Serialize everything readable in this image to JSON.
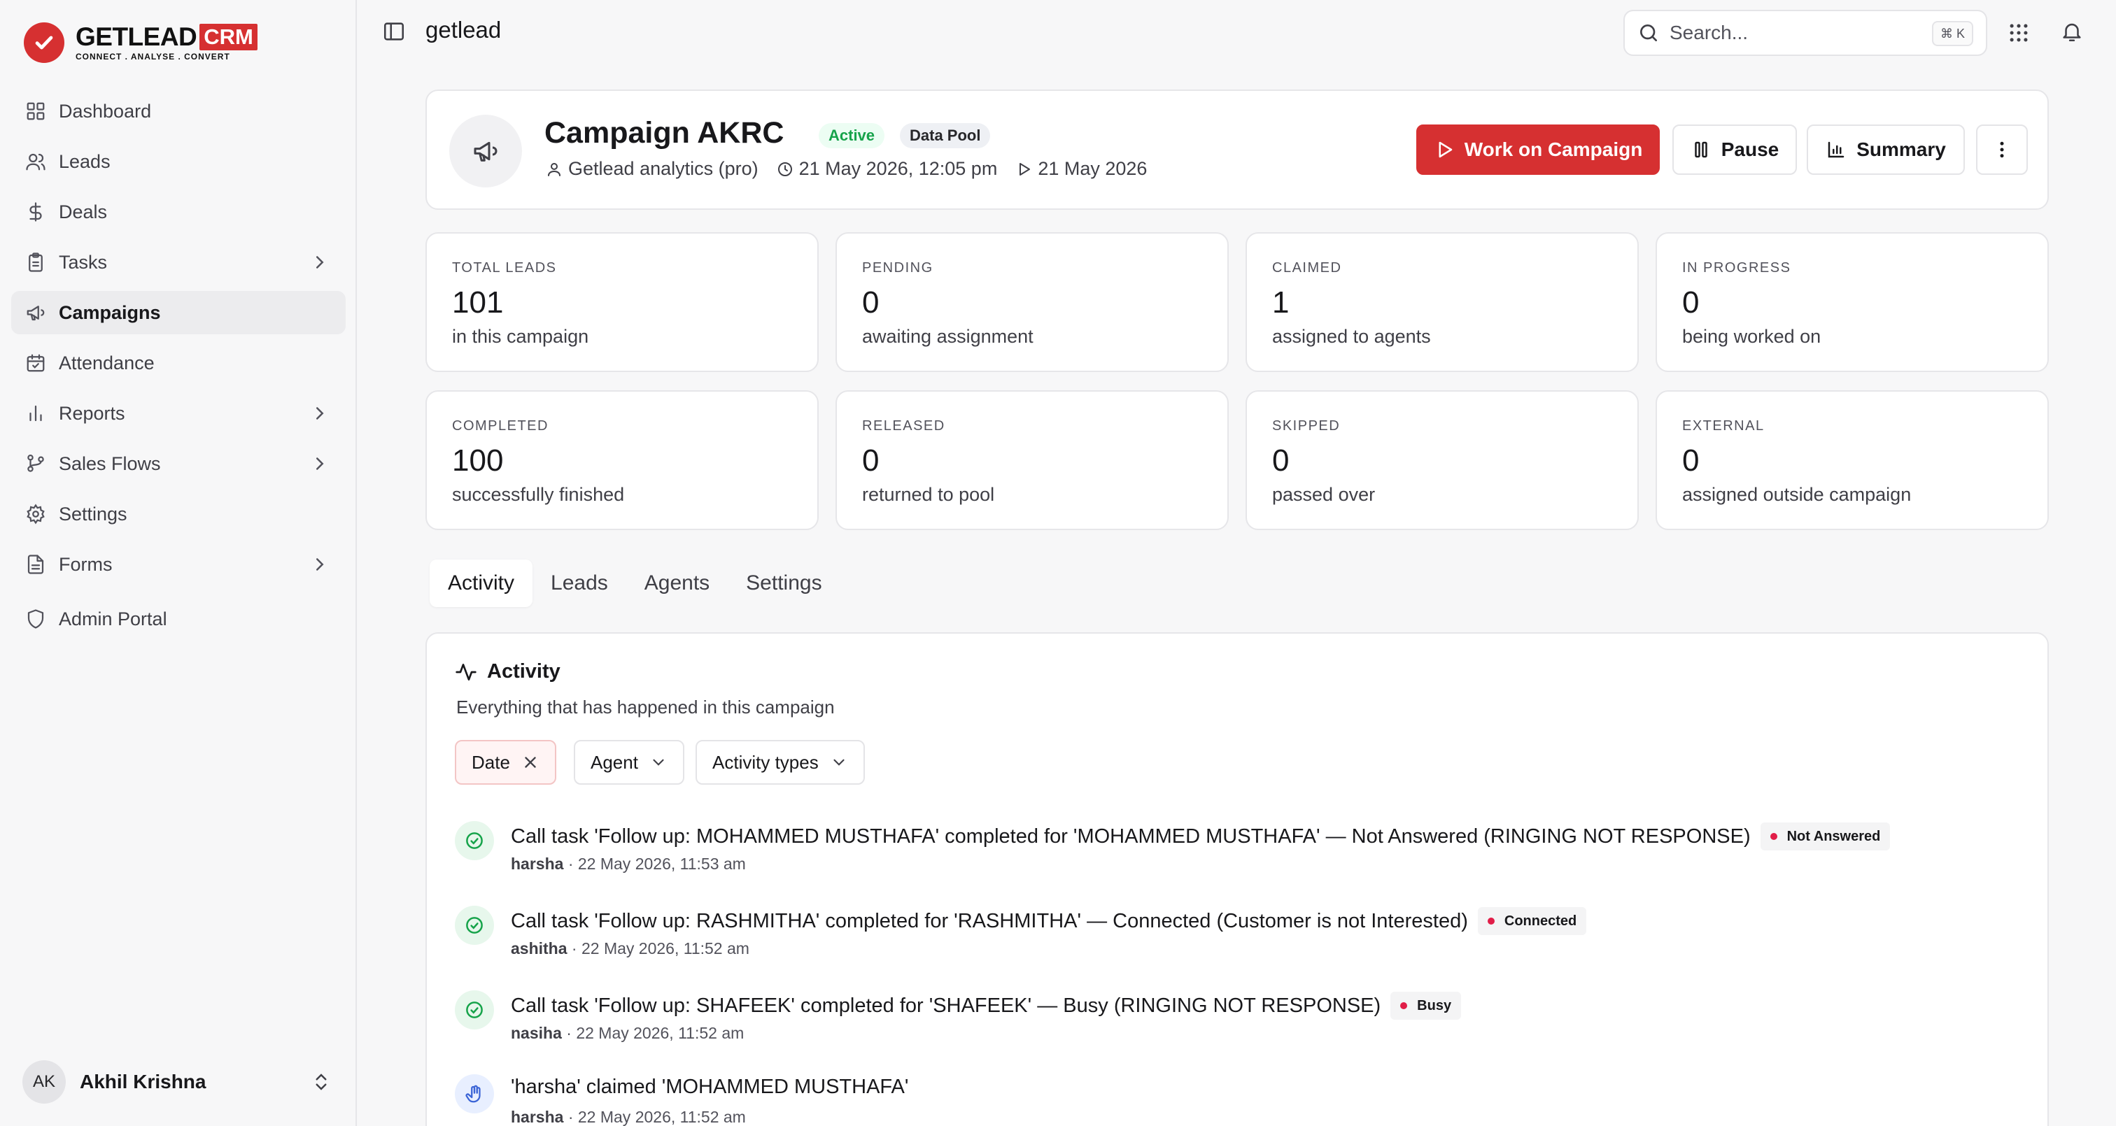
{
  "brand": {
    "logo_word": "GETLEAD",
    "logo_crm": "CRM",
    "logo_tagline": "CONNECT . ANALYSE . CONVERT",
    "accent": "#d63031"
  },
  "sidebar": {
    "items": [
      {
        "label": "Dashboard",
        "icon": "dashboard-icon"
      },
      {
        "label": "Leads",
        "icon": "users-icon"
      },
      {
        "label": "Deals",
        "icon": "dollar-icon"
      },
      {
        "label": "Tasks",
        "icon": "clipboard-icon",
        "has_children": true
      },
      {
        "label": "Campaigns",
        "icon": "megaphone-icon",
        "active": true
      },
      {
        "label": "Attendance",
        "icon": "calendar-check-icon"
      },
      {
        "label": "Reports",
        "icon": "bar-chart-icon",
        "has_children": true
      },
      {
        "label": "Sales Flows",
        "icon": "git-branch-icon",
        "has_children": true
      },
      {
        "label": "Settings",
        "icon": "gear-icon"
      },
      {
        "label": "Forms",
        "icon": "file-text-icon",
        "has_children": true
      },
      {
        "label": "Admin Portal",
        "icon": "shield-icon"
      }
    ],
    "user": {
      "initials": "AK",
      "name": "Akhil Krishna"
    }
  },
  "topbar": {
    "title": "getlead",
    "search_placeholder": "Search...",
    "search_shortcut": "⌘ K"
  },
  "campaign": {
    "title": "Campaign AKRC",
    "status_badge": "Active",
    "pool_badge": "Data Pool",
    "owner": "Getlead analytics (pro)",
    "created": "21 May 2026, 12:05 pm",
    "start_date": "21 May 2026",
    "actions": {
      "work": "Work on Campaign",
      "pause": "Pause",
      "summary": "Summary"
    }
  },
  "stats": [
    {
      "label": "TOTAL LEADS",
      "value": "101",
      "sub": "in this campaign"
    },
    {
      "label": "PENDING",
      "value": "0",
      "sub": "awaiting assignment"
    },
    {
      "label": "CLAIMED",
      "value": "1",
      "sub": "assigned to agents"
    },
    {
      "label": "IN PROGRESS",
      "value": "0",
      "sub": "being worked on"
    },
    {
      "label": "COMPLETED",
      "value": "100",
      "sub": "successfully finished"
    },
    {
      "label": "RELEASED",
      "value": "0",
      "sub": "returned to pool"
    },
    {
      "label": "SKIPPED",
      "value": "0",
      "sub": "passed over"
    },
    {
      "label": "EXTERNAL",
      "value": "0",
      "sub": "assigned outside campaign"
    }
  ],
  "tabs": [
    "Activity",
    "Leads",
    "Agents",
    "Settings"
  ],
  "activity": {
    "title": "Activity",
    "subtitle": "Everything that has happened in this campaign",
    "filters": {
      "date": "Date",
      "agent": "Agent",
      "types": "Activity types"
    },
    "items": [
      {
        "kind": "completed",
        "message": "Call task 'Follow up: MOHAMMED MUSTHAFA' completed for 'MOHAMMED MUSTHAFA' — Not Answered (RINGING NOT RESPONSE)",
        "badge": "Not Answered",
        "user": "harsha",
        "time": " · 22 May 2026, 11:53 am"
      },
      {
        "kind": "completed",
        "message": "Call task 'Follow up: RASHMITHA' completed for 'RASHMITHA' — Connected (Customer is not Interested)",
        "badge": "Connected",
        "user": "ashitha",
        "time": " · 22 May 2026, 11:52 am"
      },
      {
        "kind": "completed",
        "message": "Call task 'Follow up: SHAFEEK' completed for 'SHAFEEK' — Busy (RINGING NOT RESPONSE)",
        "badge": "Busy",
        "user": "nasiha",
        "time": " · 22 May 2026, 11:52 am"
      },
      {
        "kind": "claimed",
        "message": "'harsha' claimed 'MOHAMMED MUSTHAFA'",
        "user": "harsha",
        "time": " · 22 May 2026, 11:52 am"
      }
    ]
  }
}
